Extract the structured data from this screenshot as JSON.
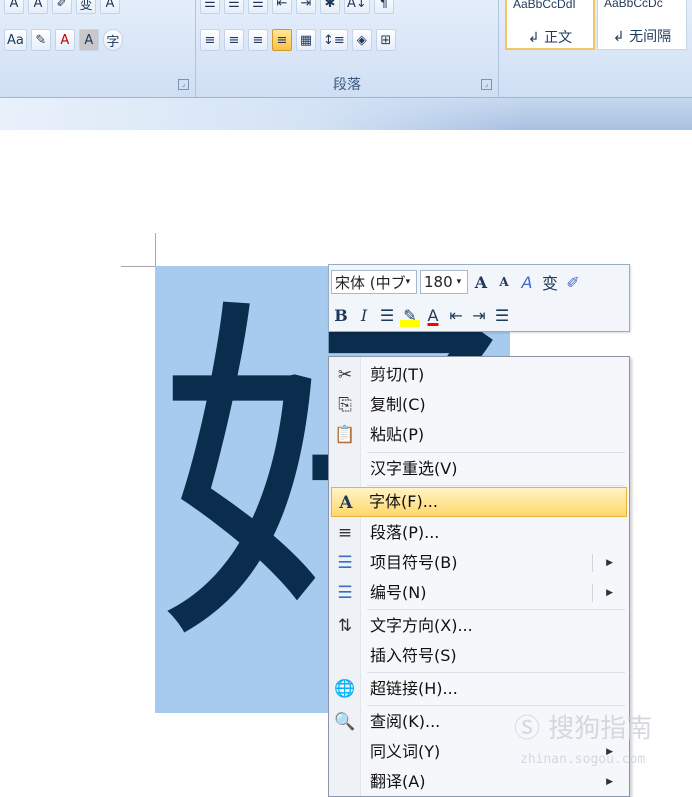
{
  "ribbon": {
    "font_group": {
      "row1": [
        "A",
        "A",
        "✐",
        "变",
        "A"
      ],
      "change_case": "Aa",
      "highlight": "✎",
      "font_color": "A",
      "char_shading": "A",
      "enclose": "字",
      "label": ""
    },
    "para_group": {
      "row1": [
        "☰",
        "☰",
        "☰",
        "⇤",
        "⇥",
        "✱",
        "A↓",
        "¶"
      ],
      "label": "段落",
      "launcher": "⌟"
    },
    "styles": {
      "card1_preview": "AaBbCcDdI",
      "card1_name": "↲ 正文",
      "card2_preview": "AaBbCcDc",
      "card2_name": "↲ 无间隔"
    },
    "font_launcher": "⌟",
    "colors": {
      "accent": "#ffbf45",
      "ribbon": "#dbe7f7"
    }
  },
  "document": {
    "character": "好",
    "selection_color": "#a6cbee"
  },
  "mini_toolbar": {
    "font_name": "宋体 (中ブ",
    "font_size": "180",
    "grow_font": "A",
    "shrink_font": "A",
    "styles_icon": "A",
    "phonetic": "变",
    "format_painter": "✐",
    "bold": "B",
    "italic": "I",
    "center": "☰",
    "highlight": "✎",
    "font_color": "A",
    "decrease_indent": "⇤",
    "increase_indent": "⇥",
    "bullets": "☰"
  },
  "context_menu": {
    "items": [
      {
        "icon": "✂",
        "label": "剪切(T)"
      },
      {
        "icon": "⎘",
        "label": "复制(C)"
      },
      {
        "icon": "📋",
        "label": "粘贴(P)"
      },
      {
        "icon": "",
        "label": "汉字重选(V)"
      },
      {
        "icon": "A",
        "label": "字体(F)..."
      },
      {
        "icon": "≡",
        "label": "段落(P)..."
      },
      {
        "icon": "☰",
        "label": "项目符号(B)"
      },
      {
        "icon": "☰",
        "label": "编号(N)"
      },
      {
        "icon": "⇅",
        "label": "文字方向(X)..."
      },
      {
        "icon": "",
        "label": "插入符号(S)"
      },
      {
        "icon": "🌐",
        "label": "超链接(H)..."
      },
      {
        "icon": "🔍",
        "label": "查阅(K)..."
      },
      {
        "icon": "",
        "label": "同义词(Y)"
      },
      {
        "icon": "",
        "label": "翻译(A)"
      }
    ],
    "submenu_arrow": "▶"
  },
  "watermark": {
    "text": "Ⓢ 搜狗指南",
    "sub": "zhinan.sogou.com"
  }
}
